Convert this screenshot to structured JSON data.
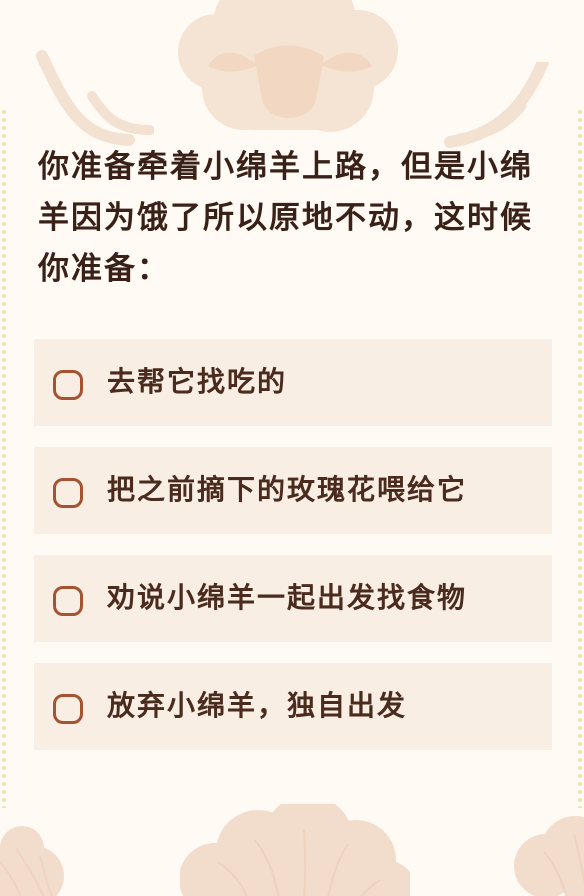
{
  "question": {
    "text": "你准备牵着小绵羊上路，但是小绵羊因为饿了所以原地不动，这时候你准备："
  },
  "options": [
    {
      "label": "去帮它找吃的"
    },
    {
      "label": "把之前摘下的玫瑰花喂给它"
    },
    {
      "label": "劝说小绵羊一起出发找食物"
    },
    {
      "label": "放弃小绵羊，独自出发"
    }
  ],
  "colors": {
    "background": "#fffaf4",
    "option_background": "#f8eee4",
    "text": "#3a2118",
    "radio_border": "#a55331",
    "decoration": "#f0dcc8"
  }
}
